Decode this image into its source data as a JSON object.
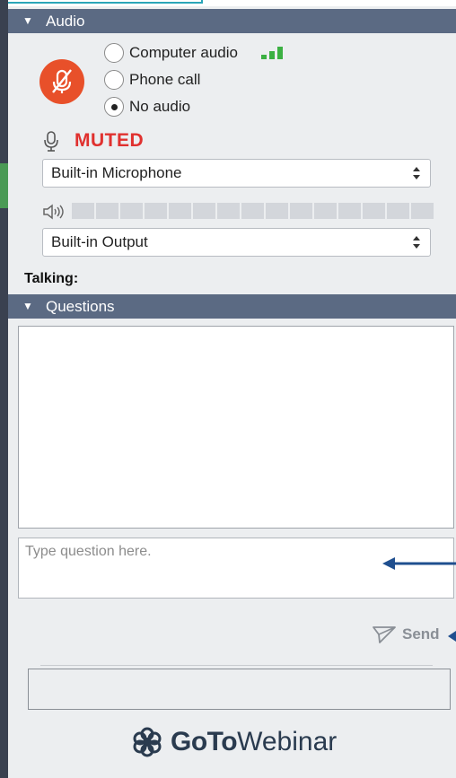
{
  "audio": {
    "header": "Audio",
    "options": [
      {
        "label": "Computer audio",
        "selected": false
      },
      {
        "label": "Phone call",
        "selected": false
      },
      {
        "label": "No audio",
        "selected": true
      }
    ],
    "status": "MUTED",
    "microphone": "Built-in Microphone",
    "output": "Built-in Output",
    "signal_color": "#3cb043",
    "mute_button_color": "#e8502a"
  },
  "talking": {
    "label": "Talking:"
  },
  "questions": {
    "header": "Questions",
    "input_placeholder": "Type question here.",
    "send_label": "Send"
  },
  "brand": {
    "bold": "GoTo",
    "light": "Webinar"
  },
  "colors": {
    "section_header": "#5b6a83",
    "panel_bg": "#eceef0",
    "annotation_arrow": "#1f4f8f",
    "muted_text": "#e0312f"
  }
}
